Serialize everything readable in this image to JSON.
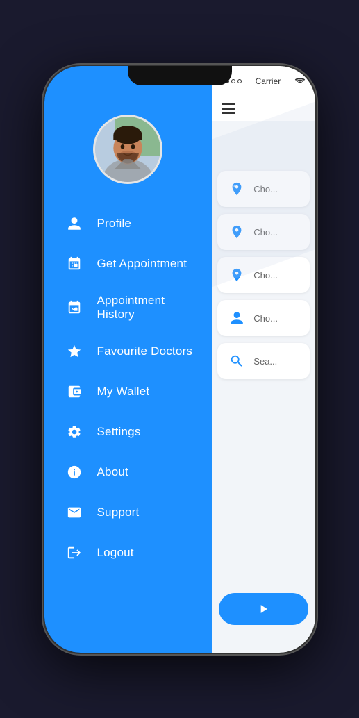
{
  "phone": {
    "notch": true
  },
  "statusBar": {
    "dots": [
      "filled",
      "filled",
      "empty",
      "empty"
    ],
    "carrier": "Carrier",
    "wifi": "wifi"
  },
  "sidebar": {
    "avatar_alt": "User profile photo",
    "menuItems": [
      {
        "id": "profile",
        "label": "Profile",
        "icon": "person"
      },
      {
        "id": "get-appointment",
        "label": "Get Appointment",
        "icon": "calendar-plus"
      },
      {
        "id": "appointment-history",
        "label": "Appointment History",
        "icon": "calendar-check"
      },
      {
        "id": "favourite-doctors",
        "label": "Favourite Doctors",
        "icon": "star"
      },
      {
        "id": "my-wallet",
        "label": "My Wallet",
        "icon": "wallet"
      },
      {
        "id": "settings",
        "label": "Settings",
        "icon": "gear"
      },
      {
        "id": "about",
        "label": "About",
        "icon": "info"
      },
      {
        "id": "support",
        "label": "Support",
        "icon": "envelope"
      },
      {
        "id": "logout",
        "label": "Logout",
        "icon": "logout"
      }
    ]
  },
  "rightPanel": {
    "cards": [
      {
        "label": "Cho...",
        "iconColor": "#1e90ff"
      },
      {
        "label": "Cho...",
        "iconColor": "#1e90ff"
      },
      {
        "label": "Cho...",
        "iconColor": "#1e90ff"
      },
      {
        "label": "Cho...",
        "iconColor": "#1e90ff"
      },
      {
        "label": "Sea...",
        "iconColor": "#1e90ff"
      }
    ]
  },
  "colors": {
    "blue": "#1e90ff",
    "bg": "#f2f5f9",
    "text": "#333"
  }
}
